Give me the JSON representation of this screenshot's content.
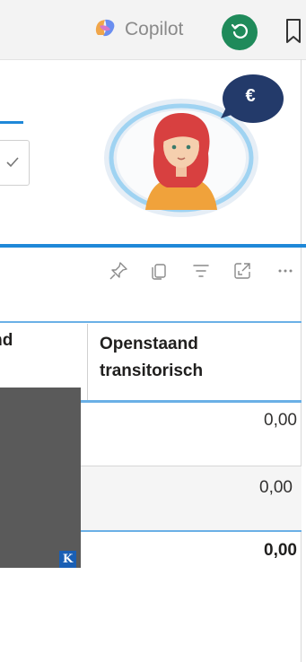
{
  "header": {
    "copilot_label": "Copilot",
    "history_button": "history-icon",
    "bookmark": "bookmark-icon"
  },
  "avatar": {
    "badge_symbol": "€"
  },
  "toolbar": {
    "icons": [
      "pin-icon",
      "copy-icon",
      "filter-icon",
      "expand-icon",
      "more-icon"
    ]
  },
  "table": {
    "columns": [
      {
        "label": "aand"
      },
      {
        "label": "Openstaand transitorisch"
      }
    ],
    "rows": [
      {
        "value": "0,00"
      },
      {
        "value": "0,00"
      }
    ],
    "total": "0,00"
  },
  "overlay": {
    "badge_letter": "K"
  },
  "colors": {
    "accent": "#1f88d8",
    "history_button": "#1f8a5a",
    "badge_navy": "#233a6a"
  }
}
